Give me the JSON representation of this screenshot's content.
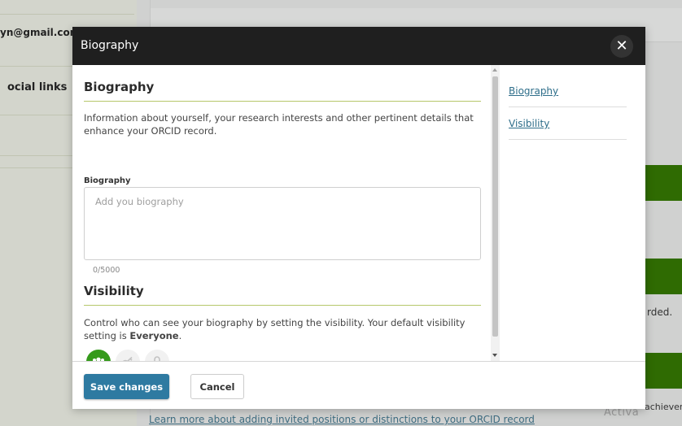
{
  "background": {
    "email_fragment": "yn@gmail.com",
    "social_links_fragment": "ocial links",
    "right_text_recorded": "rded.",
    "right_text_achieve": "achiever",
    "watermark_fragment": "Activa",
    "bottom_link": "Learn more about adding invited positions or distinctions to your ORCID record",
    "green_color": "#2f6b02"
  },
  "modal": {
    "title": "Biography",
    "close_glyph": "✕",
    "biography_section": {
      "heading": "Biography",
      "description": "Information about yourself, your research interests and other pertinent details that enhance your ORCID record.",
      "field_label": "Biography",
      "placeholder": "Add you biography",
      "value": "",
      "char_count": "0/5000"
    },
    "visibility_section": {
      "heading": "Visibility",
      "description_prefix": "Control who can see your biography by setting the visibility. Your default visibility setting is ",
      "default_value": "Everyone",
      "description_suffix": ".",
      "options": [
        {
          "name": "Everyone",
          "icon": "everyone-icon",
          "selected": true
        },
        {
          "name": "Trusted parties",
          "icon": "trusted-parties-icon",
          "selected": false
        },
        {
          "name": "Only me",
          "icon": "lock-icon",
          "selected": false
        }
      ]
    },
    "sidenav": {
      "links": [
        "Biography",
        "Visibility"
      ]
    },
    "footer": {
      "save_label": "Save changes",
      "cancel_label": "Cancel"
    },
    "colors": {
      "header_bg": "#1f1f1f",
      "accent_rule": "#b6c76a",
      "primary_button": "#2e7aa1",
      "link": "#2e6e8a",
      "selected_visibility": "#359a1b"
    }
  }
}
